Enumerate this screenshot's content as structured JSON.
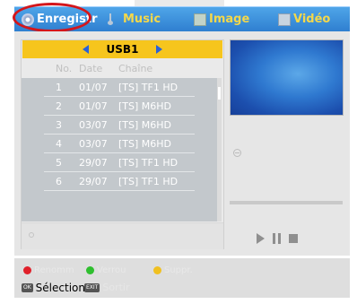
{
  "tabs": [
    {
      "label": "Enregistr",
      "icon": "disc-icon"
    },
    {
      "label": "Music",
      "icon": "music-note-icon"
    },
    {
      "label": "Image",
      "icon": "image-icon"
    },
    {
      "label": "Vidéo",
      "icon": "video-icon"
    }
  ],
  "source": {
    "label": "USB1"
  },
  "list": {
    "headers": {
      "no": "No.",
      "date": "Date",
      "channel": "Chaîne"
    },
    "rows": [
      {
        "no": "1",
        "date": "01/07",
        "channel": "[TS] TF1 HD"
      },
      {
        "no": "2",
        "date": "01/07",
        "channel": "[TS] M6HD"
      },
      {
        "no": "3",
        "date": "03/07",
        "channel": "[TS] M6HD"
      },
      {
        "no": "4",
        "date": "03/07",
        "channel": "[TS] M6HD"
      },
      {
        "no": "5",
        "date": "29/07",
        "channel": "[TS] TF1 HD"
      },
      {
        "no": "6",
        "date": "29/07",
        "channel": "[TS] TF1 HD"
      }
    ]
  },
  "legend": {
    "rename": "Renomm",
    "lock": "Verrou",
    "delete": "Suppr.",
    "select": "Sélection",
    "exit": "Sortir",
    "select_key": "OK",
    "exit_key": "EXIT"
  },
  "colors": {
    "accent_tab": "#2f7fd0",
    "tab_text": "#f4d84a",
    "usb_bar": "#f6c51d",
    "highlight_circle": "#d4161b",
    "red_button": "#e0202a",
    "green_button": "#2fbf2f",
    "yellow_button": "#f0c020"
  }
}
